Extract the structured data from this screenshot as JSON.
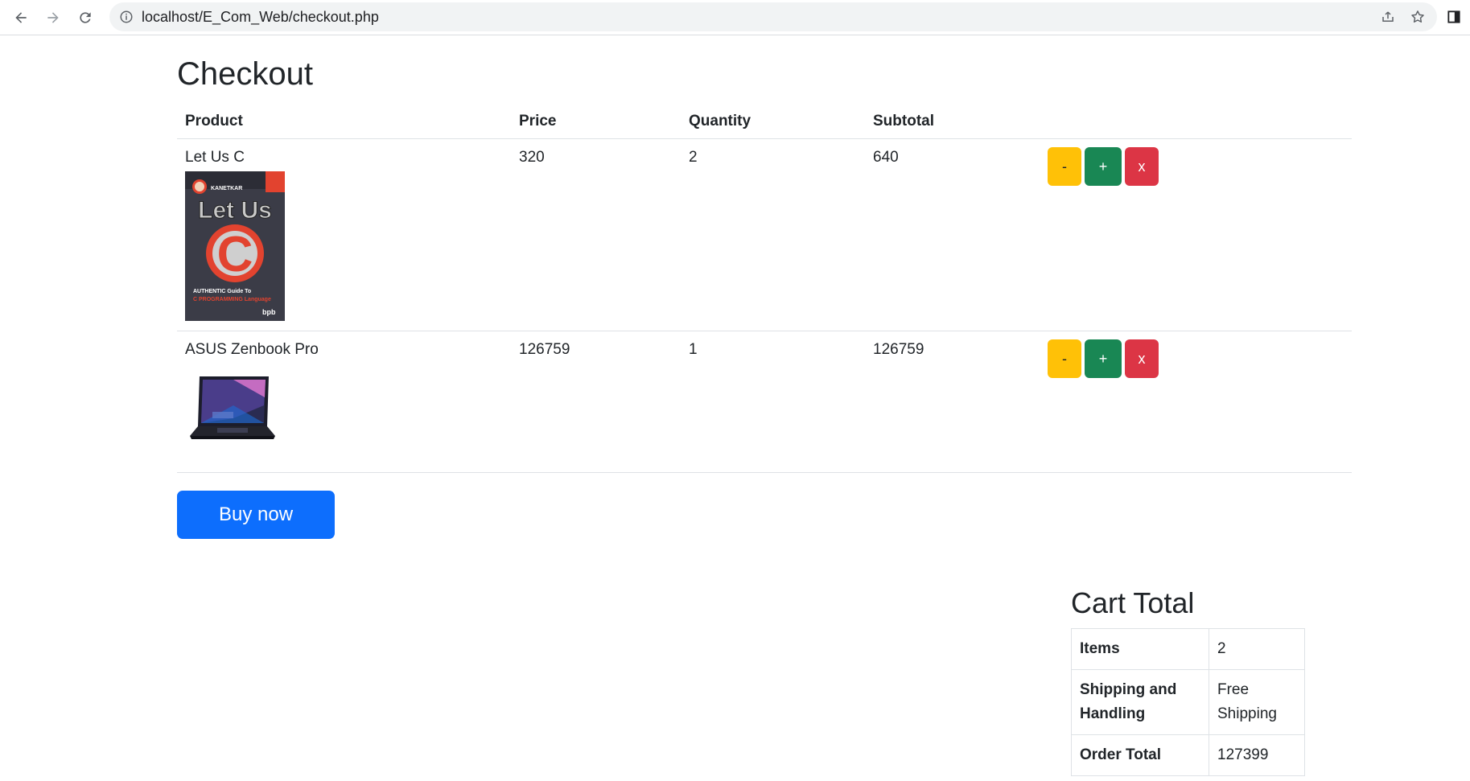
{
  "browser": {
    "url": "localhost/E_Com_Web/checkout.php"
  },
  "page": {
    "title": "Checkout"
  },
  "table": {
    "headers": [
      "Product",
      "Price",
      "Quantity",
      "Subtotal"
    ],
    "rows": [
      {
        "product": "Let Us C",
        "price": "320",
        "quantity": "2",
        "subtotal": "640",
        "image": "book-cover"
      },
      {
        "product": "ASUS Zenbook Pro",
        "price": "126759",
        "quantity": "1",
        "subtotal": "126759",
        "image": "laptop"
      }
    ],
    "actions": {
      "decrease": "-",
      "increase": "+",
      "remove": "x"
    }
  },
  "book_cover": {
    "author": "KANETKAR",
    "title": "Let Us",
    "letter": "C",
    "tagline1": "AUTHENTIC Guide To",
    "tagline2": "C PROGRAMMING Language",
    "publisher": "bpb"
  },
  "buy_button": {
    "label": "Buy now"
  },
  "cart_total": {
    "title": "Cart Total",
    "rows": [
      {
        "label": "Items",
        "value": "2"
      },
      {
        "label": "Shipping and Handling",
        "value": "Free Shipping"
      },
      {
        "label": "Order Total",
        "value": "127399"
      }
    ]
  },
  "colors": {
    "primary": "#0d6efd",
    "warning": "#ffc107",
    "success": "#198754",
    "danger": "#dc3545"
  }
}
